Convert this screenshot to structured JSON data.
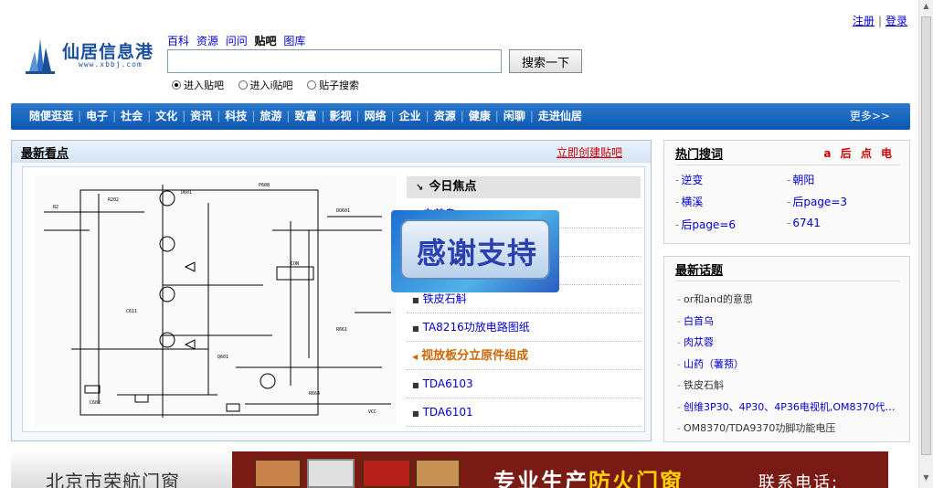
{
  "top_links": {
    "register": "注册",
    "login": "登录"
  },
  "logo": {
    "name": "仙居信息港",
    "url": "www.xbbj.com"
  },
  "search": {
    "categories": [
      "百科",
      "资源",
      "问问",
      "贴吧",
      "图库"
    ],
    "active_category": "贴吧",
    "input_value": "",
    "button_label": "搜索一下",
    "options": [
      {
        "label": "进入贴吧",
        "selected": true
      },
      {
        "label": "进入i贴吧",
        "selected": false
      },
      {
        "label": "贴子搜索",
        "selected": false
      }
    ]
  },
  "nav": {
    "items": [
      "随便逛逛",
      "电子",
      "社会",
      "文化",
      "资讯",
      "科技",
      "旅游",
      "致富",
      "影视",
      "网络",
      "企业",
      "资源",
      "健康",
      "闲聊",
      "走进仙居"
    ],
    "more_label": "更多>>"
  },
  "latest": {
    "title": "最新看点",
    "create_link": "立即创建贴吧",
    "focus_title": "今日焦点",
    "focus_items": [
      {
        "text": "白首乌",
        "highlight": false
      },
      {
        "text": "",
        "highlight": false
      },
      {
        "text": "",
        "highlight": false
      },
      {
        "text": "铁皮石斛",
        "highlight": false
      },
      {
        "text": "TA8216功放电路图纸",
        "highlight": false
      },
      {
        "text": "视放板分立原件组成",
        "highlight": true
      },
      {
        "text": "TDA6103",
        "highlight": false
      },
      {
        "text": "TDA6101",
        "highlight": false
      }
    ],
    "popup_text": "感谢支持"
  },
  "hot_keywords": {
    "title": "热门搜词",
    "extra": "a 后 点 电",
    "items": [
      "逆变",
      "朝阳",
      "横溪",
      "后page=3",
      "后page=6",
      "6741"
    ]
  },
  "latest_topics": {
    "title": "最新话题",
    "items": [
      {
        "text": "or和and的意思",
        "link": false
      },
      {
        "text": "白首乌",
        "link": true
      },
      {
        "text": "肉苁蓉",
        "link": true
      },
      {
        "text": "山药（薯蓣）",
        "link": true
      },
      {
        "text": "铁皮石斛",
        "link": false
      },
      {
        "text": "创维3P30、4P30、4P36电视机,OM8370代…",
        "link": true
      },
      {
        "text": "OM8370/TDA9370功脚功能电压",
        "link": false
      }
    ]
  },
  "banner": {
    "left_text": "北京市荣航门窗",
    "main_text_a": "专业生产",
    "main_text_b": "防火门窗",
    "phone_text": "联系电话:"
  }
}
